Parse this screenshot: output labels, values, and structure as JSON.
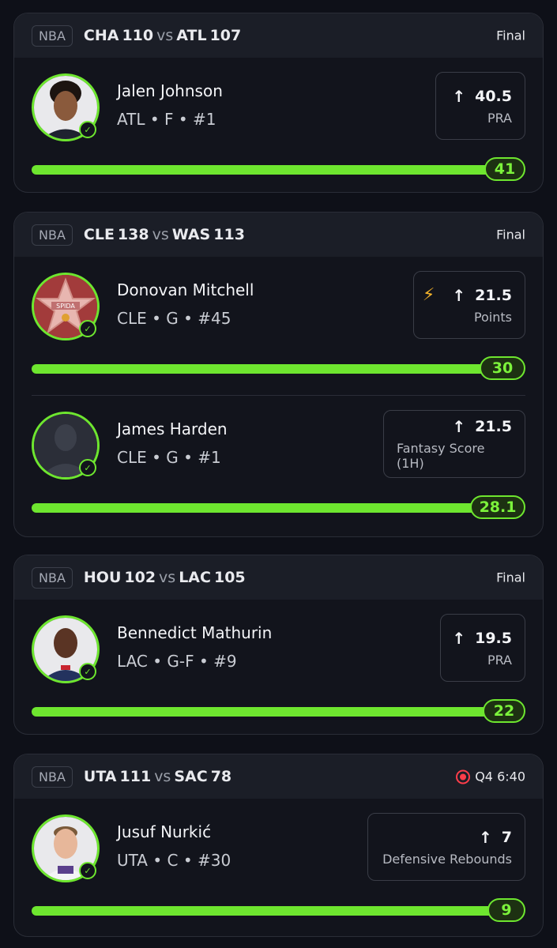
{
  "games": [
    {
      "league": "NBA",
      "home": {
        "team": "CHA",
        "score": "110"
      },
      "vs": "vs",
      "away": {
        "team": "ATL",
        "score": "107"
      },
      "status": "Final",
      "live": false,
      "players": [
        {
          "name": "Jalen Johnson",
          "meta": "ATL • F • #1",
          "line": "40.5",
          "stat": "PRA",
          "result": "41",
          "progress": 1.0,
          "boosted": false,
          "avatar_icon": "player-photo-icon"
        }
      ]
    },
    {
      "league": "NBA",
      "home": {
        "team": "CLE",
        "score": "138"
      },
      "vs": "vs",
      "away": {
        "team": "WAS",
        "score": "113"
      },
      "status": "Final",
      "live": false,
      "players": [
        {
          "name": "Donovan Mitchell",
          "meta": "CLE • G • #45",
          "line": "21.5",
          "stat": "Points",
          "result": "30",
          "progress": 1.0,
          "boosted": true,
          "avatar_icon": "star-badge-icon",
          "avatar_text": "SPIDA"
        },
        {
          "name": "James Harden",
          "meta": "CLE • G • #1",
          "line": "21.5",
          "stat": "Fantasy Score (1H)",
          "result": "28.1",
          "progress": 1.0,
          "boosted": false,
          "avatar_icon": "silhouette-icon"
        }
      ]
    },
    {
      "league": "NBA",
      "home": {
        "team": "HOU",
        "score": "102"
      },
      "vs": "vs",
      "away": {
        "team": "LAC",
        "score": "105"
      },
      "status": "Final",
      "live": false,
      "players": [
        {
          "name": "Bennedict Mathurin",
          "meta": "LAC • G-F • #9",
          "line": "19.5",
          "stat": "PRA",
          "result": "22",
          "progress": 1.0,
          "boosted": false,
          "avatar_icon": "player-photo-icon"
        }
      ]
    },
    {
      "league": "NBA",
      "home": {
        "team": "UTA",
        "score": "111"
      },
      "vs": "vs",
      "away": {
        "team": "SAC",
        "score": "78"
      },
      "status": "Q4 6:40",
      "live": true,
      "players": [
        {
          "name": "Jusuf Nurkić",
          "meta": "UTA • C • #30",
          "line": "7",
          "stat": "Defensive Rebounds",
          "result": "9",
          "progress": 1.0,
          "boosted": false,
          "avatar_icon": "player-photo-icon"
        }
      ]
    }
  ],
  "colors": {
    "accent": "#6ee62f",
    "live": "#ff3d4a",
    "bolt": "#f3b32b"
  }
}
